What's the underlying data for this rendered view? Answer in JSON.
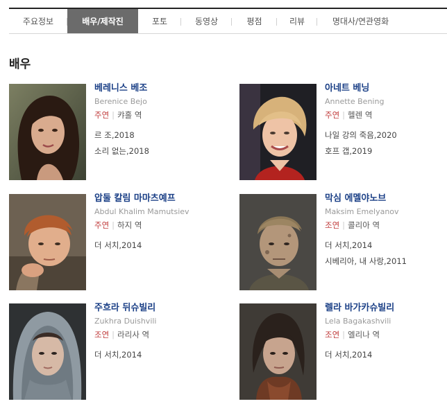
{
  "tabs": [
    {
      "label": "주요정보",
      "active": false
    },
    {
      "label": "배우/제작진",
      "active": true
    },
    {
      "label": "포토",
      "active": false
    },
    {
      "label": "동영상",
      "active": false
    },
    {
      "label": "평점",
      "active": false
    },
    {
      "label": "리뷰",
      "active": false
    },
    {
      "label": "명대사/연관영화",
      "active": false
    }
  ],
  "section_title": "배우",
  "actors": [
    {
      "korean_name": "베레니스 베조",
      "english_name": "Berenice Bejo",
      "role_type": "주연",
      "role_name": "캬홀 역",
      "films": [
        "르 조,2018",
        "소리 없는,2018"
      ]
    },
    {
      "korean_name": "아네트 베닝",
      "english_name": "Annette Bening",
      "role_type": "주연",
      "role_name": "헬렌 역",
      "films": [
        "나일 강의 죽음,2020",
        "호프 갭,2019"
      ]
    },
    {
      "korean_name": "압둘 칼림 마마츠예프",
      "english_name": "Abdul Khalim Mamutsiev",
      "role_type": "주연",
      "role_name": "하지 역",
      "films": [
        "더 서치,2014"
      ]
    },
    {
      "korean_name": "막심 에멜야노브",
      "english_name": "Maksim Emelyanov",
      "role_type": "조연",
      "role_name": "콜리아 역",
      "films": [
        "더 서치,2014",
        "시베리아, 내 사랑,2011"
      ]
    },
    {
      "korean_name": "주흐라 뒤슈빌리",
      "english_name": "Zukhra Duishvili",
      "role_type": "조연",
      "role_name": "라리사 역",
      "films": [
        "더 서치,2014"
      ]
    },
    {
      "korean_name": "렐라 바가카슈빌리",
      "english_name": "Lela Bagakashvili",
      "role_type": "조연",
      "role_name": "엘리나 역",
      "films": [
        "더 서치,2014"
      ]
    }
  ],
  "colors": {
    "tab_active_bg": "#6b6b6b",
    "name_blue": "#1a3f86",
    "role_red": "#c03c3c"
  }
}
